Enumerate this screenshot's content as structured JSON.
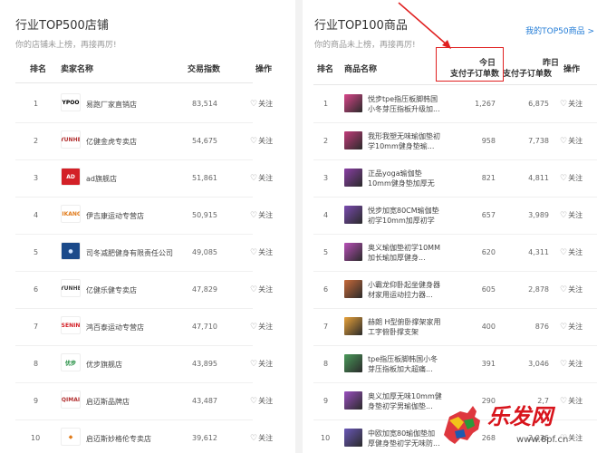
{
  "left": {
    "title": "行业TOP500店铺",
    "subtitle": "你的店铺未上榜，再接再厉!",
    "headers": {
      "rank": "排名",
      "seller": "卖家名称",
      "index": "交易指数",
      "action": "操作"
    },
    "rows": [
      {
        "rank": "1",
        "logo": "YPOO",
        "logo_bg": "#ffffff",
        "logo_fg": "#000000",
        "name": "易跑厂家直销店",
        "index": "83,514",
        "follow": "关注"
      },
      {
        "rank": "2",
        "logo": "YUNHE",
        "logo_bg": "#ffffff",
        "logo_fg": "#b23030",
        "name": "亿健金虎专卖店",
        "index": "54,675",
        "follow": "关注"
      },
      {
        "rank": "3",
        "logo": "AD",
        "logo_bg": "#d32027",
        "logo_fg": "#ffffff",
        "name": "ad旗舰店",
        "index": "51,861",
        "follow": "关注"
      },
      {
        "rank": "4",
        "logo": "JIKANG",
        "logo_bg": "#ffffff",
        "logo_fg": "#e07a1a",
        "name": "伊吉康运动专营店",
        "index": "50,915",
        "follow": "关注"
      },
      {
        "rank": "5",
        "logo": "●",
        "logo_bg": "#1b4a8a",
        "logo_fg": "#cfe3ff",
        "name": "司冬减肥健身有限责任公司",
        "index": "49,085",
        "follow": "关注"
      },
      {
        "rank": "6",
        "logo": "YUNHE",
        "logo_bg": "#ffffff",
        "logo_fg": "#444444",
        "name": "亿健乐健专卖店",
        "index": "47,829",
        "follow": "关注"
      },
      {
        "rank": "7",
        "logo": "SENIN",
        "logo_bg": "#ffffff",
        "logo_fg": "#d32027",
        "name": "鸿百泰运动专营店",
        "index": "47,710",
        "follow": "关注"
      },
      {
        "rank": "8",
        "logo": "优步",
        "logo_bg": "#ffffff",
        "logo_fg": "#1a8a3a",
        "name": "优步旗舰店",
        "index": "43,895",
        "follow": "关注"
      },
      {
        "rank": "9",
        "logo": "QIMAI",
        "logo_bg": "#ffffff",
        "logo_fg": "#b23030",
        "name": "启迈斯品牌店",
        "index": "43,487",
        "follow": "关注"
      },
      {
        "rank": "10",
        "logo": "◆",
        "logo_bg": "#ffffff",
        "logo_fg": "#e07a1a",
        "name": "启迈斯妙格伦专卖店",
        "index": "39,612",
        "follow": "关注"
      }
    ]
  },
  "right": {
    "title": "行业TOP100商品",
    "subtitle": "你的商品未上榜，再接再厉!",
    "top50_link": "我的TOP50商品 >",
    "headers": {
      "rank": "排名",
      "product": "商品名称",
      "today_1": "今日",
      "today_2": "支付子订单数",
      "yesterday_1": "昨日",
      "yesterday_2": "支付子订单数",
      "action": "操作"
    },
    "rows": [
      {
        "rank": "1",
        "thumb": "#d9468a",
        "name": "悦步tpe指压板脚韩国小冬芽压指板升级加...",
        "today": "1,267",
        "yesterday": "6,875",
        "follow": "关注"
      },
      {
        "rank": "2",
        "thumb": "#c23b7a",
        "name": "我形我塑无味瑜伽垫初学10mm健身垫瑜...",
        "today": "958",
        "yesterday": "7,738",
        "follow": "关注"
      },
      {
        "rank": "3",
        "thumb": "#8a3fa5",
        "name": "正品yoga瑜伽垫10mm健身垫加厚无味...",
        "today": "821",
        "yesterday": "4,811",
        "follow": "关注"
      },
      {
        "rank": "4",
        "thumb": "#7a4bb0",
        "name": "悦步加宽80CM瑜伽垫初学10mm加厚初学无...",
        "today": "657",
        "yesterday": "3,989",
        "follow": "关注"
      },
      {
        "rank": "5",
        "thumb": "#b84fb8",
        "name": "奥义瑜伽垫初学10MM加长瑜加厚健身...",
        "today": "620",
        "yesterday": "4,311",
        "follow": "关注"
      },
      {
        "rank": "6",
        "thumb": "#c86a3a",
        "name": "小霸龙仰卧起坐健身器材家用运动拉力器...",
        "today": "605",
        "yesterday": "2,878",
        "follow": "关注"
      },
      {
        "rank": "7",
        "thumb": "#e8a23a",
        "name": "赫朗 H型俯卧撑架家用工字俯卧撑支架",
        "today": "400",
        "yesterday": "876",
        "follow": "关注"
      },
      {
        "rank": "8",
        "thumb": "#4a9a5a",
        "name": "tpe指压板脚韩国小冬芽压指板加大超痛...",
        "today": "391",
        "yesterday": "3,046",
        "follow": "关注"
      },
      {
        "rank": "9",
        "thumb": "#9a4fc0",
        "name": "奥义加厚无味10mm健身垫初学男瑜伽垫...",
        "today": "290",
        "yesterday": "2,7",
        "follow": "关注"
      },
      {
        "rank": "10",
        "thumb": "#6a58b8",
        "name": "中欧加宽80瑜伽垫加厚健身垫初学无味防...",
        "today": "268",
        "yesterday": "2,036",
        "follow": "关注"
      }
    ]
  },
  "watermark": {
    "brand": "乐发网",
    "url": "www.6pf.cn"
  },
  "colors": {
    "highlight_box": "#e02020",
    "link": "#1f7ad6",
    "watermark_red": "#d8141c"
  }
}
